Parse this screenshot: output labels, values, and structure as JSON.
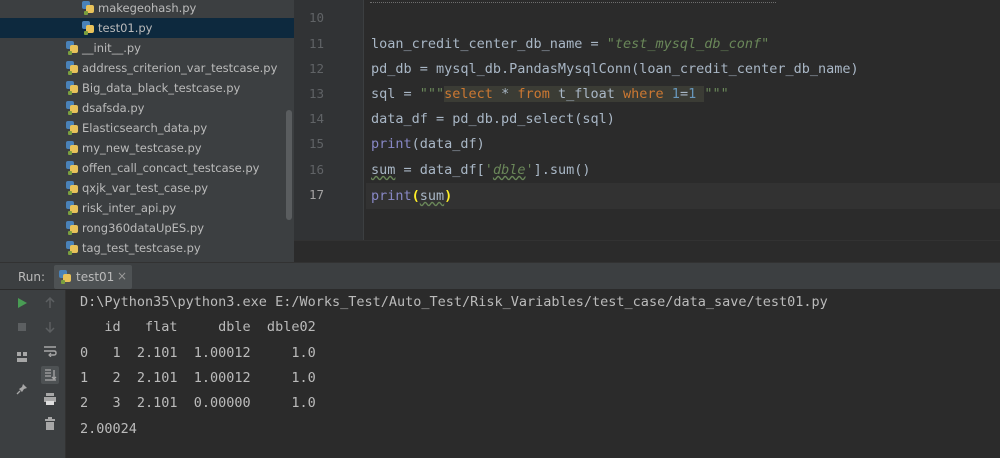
{
  "project_tree": {
    "items": [
      {
        "name": "makegeohash.py"
      },
      {
        "name": "test01.py"
      },
      {
        "name": "__init__.py"
      },
      {
        "name": "address_criterion_var_testcase.py"
      },
      {
        "name": "Big_data_black_testcase.py"
      },
      {
        "name": "dsafsda.py"
      },
      {
        "name": "Elasticsearch_data.py"
      },
      {
        "name": "my_new_testcase.py"
      },
      {
        "name": "offen_call_concact_testcase.py"
      },
      {
        "name": "qxjk_var_test_case.py"
      },
      {
        "name": "risk_inter_api.py"
      },
      {
        "name": "rong360dataUpES.py"
      },
      {
        "name": "tag_test_testcase.py"
      }
    ],
    "selected": "test01.py"
  },
  "editor": {
    "line_numbers": [
      "10",
      "11",
      "12",
      "13",
      "14",
      "15",
      "16",
      "17"
    ],
    "current_line": "17",
    "tokens": {
      "l11_var": "loan_credit_center_db_name",
      "l11_eq": " = ",
      "l11_str": "\"test_mysql_db_conf\"",
      "l12_a": "pd_db = mysql_db.PandasMysqlConn(loan_credit_center_db_name)",
      "l13_a": "sql = ",
      "l13_q1": "\"\"\"",
      "l13_k1": "select",
      "l13_b1": " * ",
      "l13_k2": "from",
      "l13_b2": " t_float ",
      "l13_k3": "where",
      "l13_b3": " ",
      "l13_n1": "1",
      "l13_b4": "=",
      "l13_n2": "1",
      "l13_b5": " ",
      "l13_q2": "\"\"\"",
      "l14_a": "data_df = pd_db.pd_select(sql)",
      "l15_p": "print",
      "l15_r": "(data_df)",
      "l16_a": "sum",
      "l16_b": " = data_df[",
      "l16_s1": "'",
      "l16_s2": "dble",
      "l16_s3": "'",
      "l16_c": "].sum()",
      "l17_p": "print",
      "l17_o": "(",
      "l17_m": "sum",
      "l17_c": ")"
    }
  },
  "run_panel": {
    "label": "Run:",
    "tab_label": "test01",
    "close_glyph": "×"
  },
  "console": {
    "lines": [
      "D:\\Python35\\python3.exe E:/Works_Test/Auto_Test/Risk_Variables/test_case/data_save/test01.py",
      "   id   flat     dble  dble02",
      "0   1  2.101  1.00012     1.0",
      "1   2  2.101  1.00012     1.0",
      "2   3  2.101  0.00000     1.0",
      "2.00024"
    ]
  }
}
